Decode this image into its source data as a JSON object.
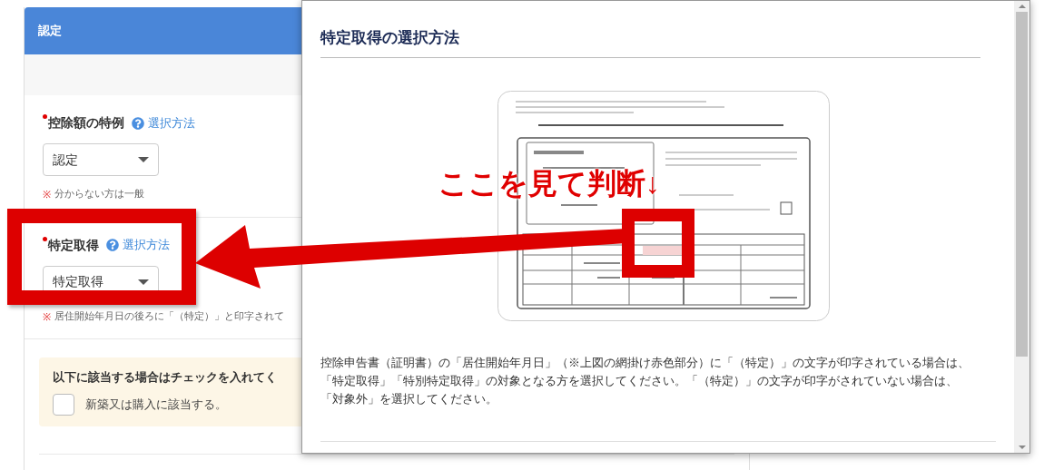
{
  "panel": {
    "title": "認定"
  },
  "fields": [
    {
      "label": "控除額の特例",
      "required": true,
      "help_link": "選択方法",
      "value": "認定",
      "note_mark": "※",
      "note": "分からない方は一般"
    },
    {
      "label": "特定取得",
      "required": true,
      "help_link": "選択方法",
      "value": "特定取得",
      "note_mark": "※",
      "note": "居住開始年月日の後ろに「（特定）」と印字されて"
    }
  ],
  "checkbox_group": {
    "heading": "以下に該当する場合はチェックを入れてく",
    "items": [
      {
        "label": "新築又は購入に該当する。",
        "checked": false
      }
    ]
  },
  "modal": {
    "title": "特定取得の選択方法",
    "body": "控除申告書（証明書）の「居住開始年月日」（※上図の網掛け赤色部分）に「（特定）」の文字が印字されている場合は、「特定取得」「特別特定取得」の対象となる方を選択してください。「（特定）」の文字が印字がされていない場合は、「対象外」を選択してください。"
  },
  "annotation": {
    "text": "ここを見て判断↓"
  }
}
